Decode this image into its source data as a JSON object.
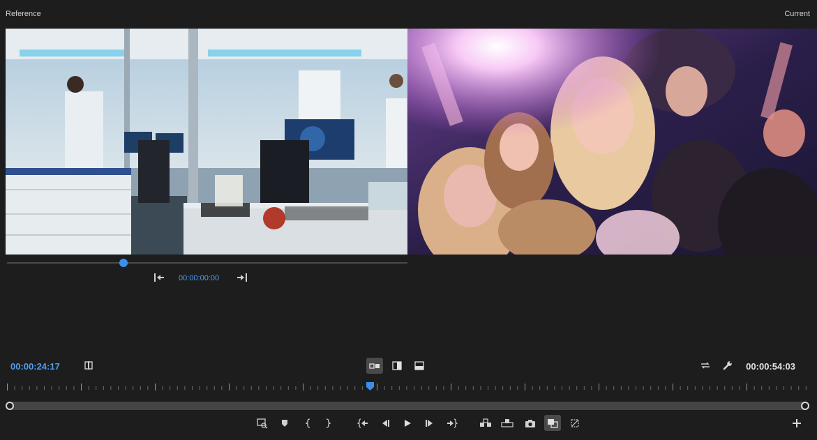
{
  "header": {
    "reference_label": "Reference",
    "current_label": "Current"
  },
  "reference_monitor": {
    "timecode": "00:00:00:00",
    "scrub_position": 0.29
  },
  "program": {
    "current_timecode": "00:00:24:17",
    "duration_timecode": "00:00:54:03",
    "playhead_position": 0.45
  },
  "colors": {
    "accent_blue": "#3c8fe8",
    "timecode_blue": "#4d9cf0",
    "background": "#1d1d1d"
  },
  "icons": {
    "comparison_view": [
      "side-by-side-icon",
      "vertical-split-icon",
      "horizontal-split-icon"
    ],
    "transport": [
      "add-marker-icon",
      "mark-in-icon",
      "mark-out-icon",
      "go-to-in-icon",
      "step-back-icon",
      "play-icon",
      "step-forward-icon",
      "go-to-out-icon"
    ],
    "edit": [
      "insert-icon",
      "overwrite-icon",
      "export-frame-icon",
      "comparison-view-icon",
      "proxy-toggle-icon",
      "button-editor-icon"
    ]
  }
}
